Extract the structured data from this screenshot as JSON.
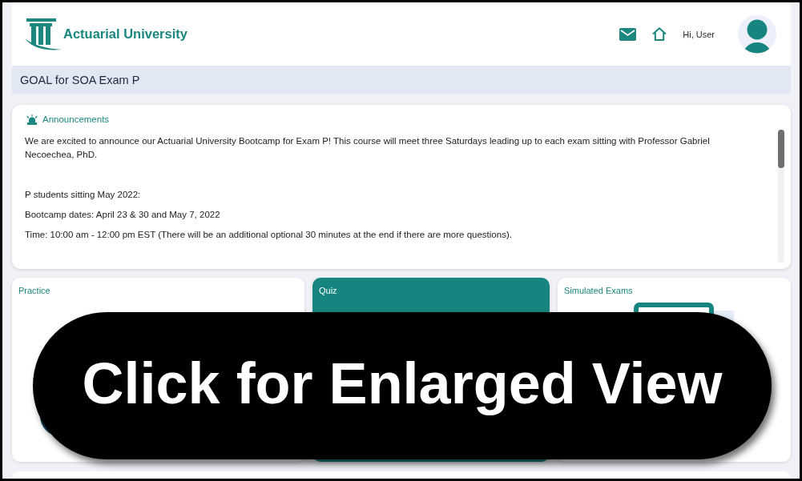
{
  "header": {
    "brand": "Actuarial University",
    "greeting": "Hi, User"
  },
  "goal_bar": {
    "title": "GOAL for SOA Exam P"
  },
  "announcements": {
    "title": "Announcements",
    "intro": "We are excited to announce our Actuarial University Bootcamp for Exam P! This course will meet three Saturdays leading up to each exam sitting with Professor Gabriel Necoechea, PhD.",
    "details": [
      "P students sitting May 2022:",
      "Bootcamp dates: April 23 & 30 and May 7, 2022",
      "Time: 10:00 am - 12:00 pm EST (There will be an additional optional 30 minutes at the end if there are more questions)."
    ]
  },
  "cards": [
    {
      "title": "Practice",
      "kind": "practice",
      "selected": false
    },
    {
      "title": "Quiz",
      "kind": "quiz",
      "selected": true
    },
    {
      "title": "Simulated Exams",
      "kind": "exam",
      "selected": false
    }
  ],
  "overlay": {
    "label": "Click for Enlarged View"
  }
}
